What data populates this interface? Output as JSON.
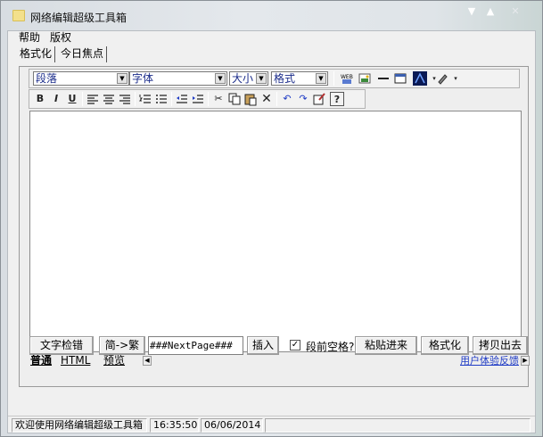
{
  "window": {
    "title": "网络编辑超级工具箱",
    "controls": {
      "minimize": "▼",
      "maximize": "▲",
      "close": "✕"
    }
  },
  "menu": {
    "items": [
      "帮助",
      "版权"
    ]
  },
  "top_tabs": [
    "格式化",
    "今日焦点"
  ],
  "toolbar": {
    "paragraph_select": "段落",
    "font_select": "字体",
    "size_select": "大小",
    "style_select": "格式",
    "icons_row1": [
      "web-icon",
      "image-icon",
      "horizontal-rule-icon",
      "table-icon",
      "text-color-icon",
      "highlight-icon"
    ],
    "icons_row2": [
      "bold-icon",
      "italic-icon",
      "underline-icon",
      "align-left-icon",
      "align-center-icon",
      "align-right-icon",
      "ordered-list-icon",
      "unordered-list-icon",
      "outdent-icon",
      "indent-icon",
      "cut-icon",
      "copy-icon",
      "paste-icon",
      "delete-icon",
      "undo-icon",
      "redo-icon",
      "edit-icon",
      "help-icon"
    ],
    "bold": "B",
    "italic": "I",
    "underline": "U"
  },
  "bottom_tabs": [
    "普通",
    "HTML",
    "预览"
  ],
  "feedback_link": "用户体验反馈",
  "actions": {
    "check": "文字检错",
    "convert": "简->繁",
    "separator_value": "###NextPage###",
    "insert": "插入",
    "indent_checkbox_label": "段前空格?",
    "indent_checked": true,
    "paste_in": "粘贴进来",
    "format": "格式化",
    "copy_out": "拷贝出去"
  },
  "status": {
    "welcome": "欢迎使用网络编辑超级工具箱",
    "time": "16:35:50",
    "date": "06/06/2014"
  }
}
